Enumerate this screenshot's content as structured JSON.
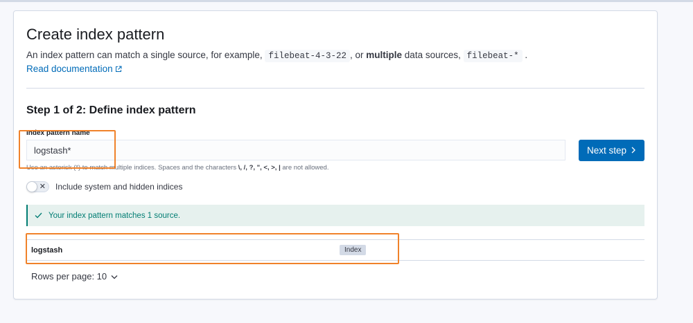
{
  "header": {
    "title": "Create index pattern",
    "desc_prefix": "An index pattern can match a single source, for example,",
    "example_single": "filebeat-4-3-22",
    "desc_middle": ", or",
    "desc_bold": "multiple",
    "desc_after_bold": "data sources,",
    "example_multi": "filebeat-*",
    "desc_suffix": ".",
    "doc_link": "Read documentation"
  },
  "step": {
    "title": "Step 1 of 2: Define index pattern",
    "field_label": "Index pattern name",
    "input_value": "logstash*",
    "help_prefix": "Use an asterisk (*) to match multiple indices. Spaces and the characters",
    "help_chars": "\\, /, ?, \", <, >, |",
    "help_suffix": "are not allowed.",
    "next_button": "Next step",
    "toggle_label": "Include system and hidden indices",
    "toggle_on": false
  },
  "callout": {
    "text": "Your index pattern matches 1 source."
  },
  "table": {
    "rows": [
      {
        "name": "logstash",
        "badge": "Index"
      }
    ]
  },
  "pagination": {
    "label": "Rows per page: 10"
  },
  "colors": {
    "primary": "#006bb8",
    "success": "#017d73",
    "success_bg": "#e6f1ee",
    "highlight": "#f0822a"
  }
}
